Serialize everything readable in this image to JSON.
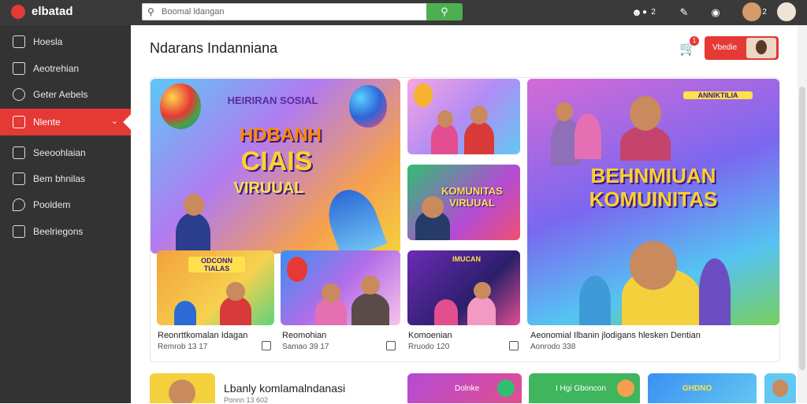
{
  "app": {
    "logo_text": "elbatad"
  },
  "search": {
    "placeholder": "Boomal ldangan"
  },
  "colors": {
    "accent": "#e53935",
    "search_button": "#4caf50",
    "sidebar_bg": "#333333",
    "topbar_bg": "#3a3a3a"
  },
  "topbar": {
    "icons": [
      "person-icon",
      "tag-icon",
      "bell-icon",
      "avatar"
    ],
    "count": "2"
  },
  "sidebar": {
    "items": [
      {
        "label": "Hoesla",
        "icon": "home-icon"
      },
      {
        "label": "Aeotrehian",
        "icon": "house-icon"
      },
      {
        "label": "Geter Aebels",
        "icon": "settings-icon"
      },
      {
        "label": "Nlente",
        "icon": "video-icon",
        "active": true
      },
      {
        "label": "Seeoohlaian",
        "icon": "home-outline-icon"
      },
      {
        "label": "Bem bhnilas",
        "icon": "list-icon"
      },
      {
        "label": "Pooldem",
        "icon": "pin-icon"
      },
      {
        "label": "Beelriegons",
        "icon": "bookmark-icon"
      }
    ]
  },
  "header": {
    "title": "Ndarans Indanniana",
    "cart_count": "1",
    "button_label": "Vbedie"
  },
  "feature": {
    "main_banner": {
      "small_title": "HEIRIRAN SOSIAL",
      "title_line1": "HDBANH",
      "title_line2": "CIAIS",
      "title_line3": "VIRUUAL"
    },
    "tiles": [
      {
        "overlay": "KOMUNITAS VIRUUAL"
      },
      {
        "overlay": "BEHNMIUAN KOMUINITAS",
        "small": "ANNIKTILIA"
      },
      {
        "overlay": "ODCONN TIALAS"
      },
      {
        "overlay": "IMUCAN"
      }
    ],
    "captions": [
      {
        "title": "Reonrttkomalan Idagan",
        "meta": "Remrob 13 17"
      },
      {
        "title": "Reomohian",
        "meta": "Samao 39 17"
      },
      {
        "title": "Komoenian",
        "meta": "Rruodo 120"
      },
      {
        "title": "Aeonomial Ilbanin jlodigans hlesken Dentian",
        "meta": "Aonrodo 338"
      }
    ]
  },
  "second_row": {
    "title": "Lbanly komlamalndanasi",
    "subtitle": "Ponnn 13 602",
    "pills": [
      "Dolnke",
      "I Hgi Gboncon",
      "GHDNO"
    ]
  }
}
